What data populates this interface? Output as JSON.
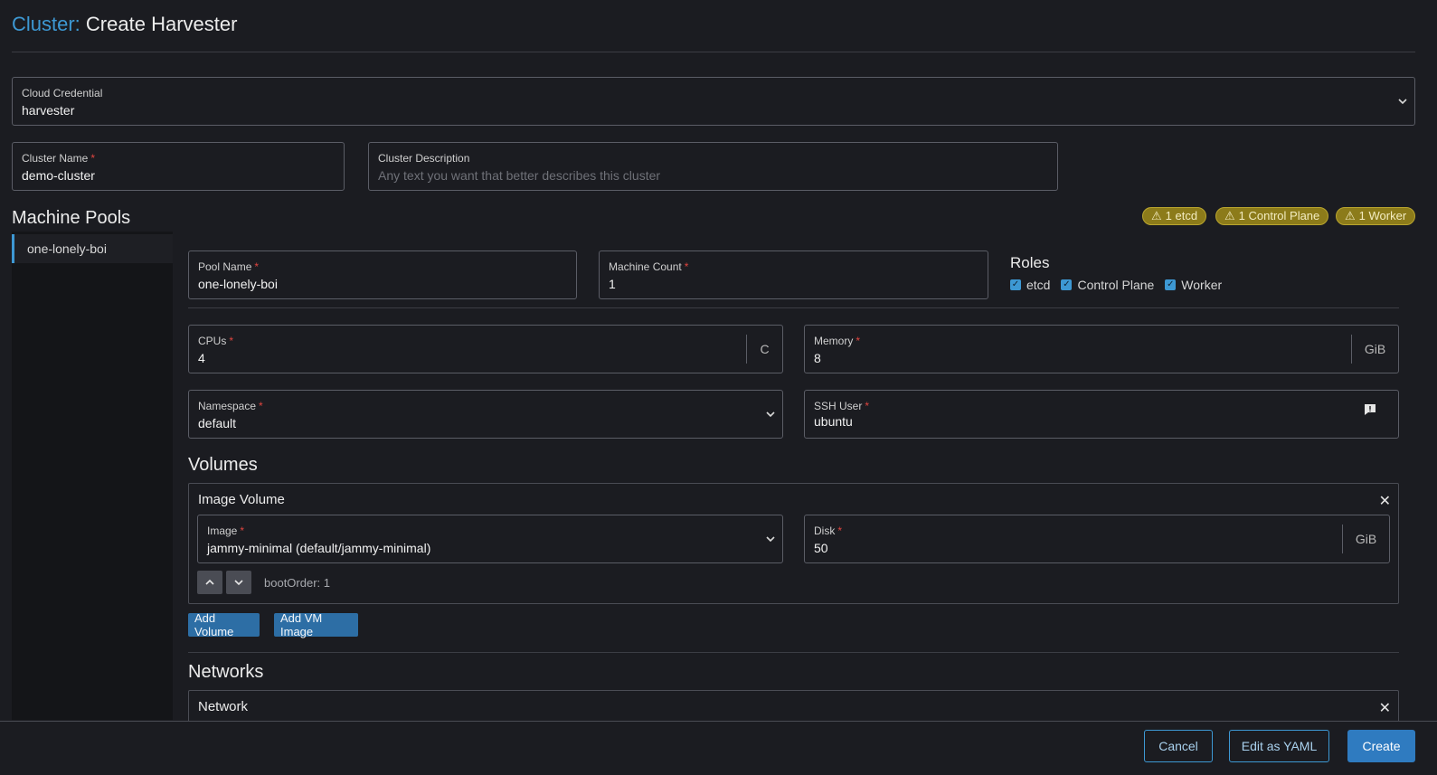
{
  "header": {
    "prefix": "Cluster:",
    "title": "Create Harvester"
  },
  "cloud_credential": {
    "label": "Cloud Credential",
    "value": "harvester"
  },
  "cluster_name": {
    "label": "Cluster Name",
    "value": "demo-cluster"
  },
  "cluster_description": {
    "label": "Cluster Description",
    "placeholder": "Any text you want that better describes this cluster"
  },
  "machine_pools": {
    "title": "Machine Pools",
    "items": [
      {
        "label": "one-lonely-boi"
      }
    ],
    "badges": [
      {
        "label": "1 etcd"
      },
      {
        "label": "1 Control Plane"
      },
      {
        "label": "1 Worker"
      }
    ]
  },
  "pool": {
    "pool_name": {
      "label": "Pool Name",
      "value": "one-lonely-boi"
    },
    "machine_count": {
      "label": "Machine Count",
      "value": "1"
    },
    "roles": {
      "title": "Roles",
      "items": [
        {
          "label": "etcd",
          "checked": true
        },
        {
          "label": "Control Plane",
          "checked": true
        },
        {
          "label": "Worker",
          "checked": true
        }
      ]
    },
    "cpus": {
      "label": "CPUs",
      "value": "4",
      "unit": "C"
    },
    "memory": {
      "label": "Memory",
      "value": "8",
      "unit": "GiB"
    },
    "namespace": {
      "label": "Namespace",
      "value": "default"
    },
    "ssh_user": {
      "label": "SSH User",
      "value": "ubuntu"
    }
  },
  "volumes": {
    "title": "Volumes",
    "image_volume": {
      "title": "Image Volume",
      "image": {
        "label": "Image",
        "value": "jammy-minimal (default/jammy-minimal)"
      },
      "disk": {
        "label": "Disk",
        "value": "50",
        "unit": "GiB"
      },
      "boot_order": "bootOrder: 1"
    },
    "add_volume": "Add Volume",
    "add_vm_image": "Add VM Image"
  },
  "networks": {
    "title": "Networks",
    "network_title": "Network"
  },
  "footer": {
    "cancel": "Cancel",
    "edit_yaml": "Edit as YAML",
    "create": "Create"
  },
  "colors": {
    "accent": "#3d98d3",
    "warning_badge": "#8c7b1a",
    "primary_button": "#2f7bc0",
    "required": "#e0453f"
  }
}
